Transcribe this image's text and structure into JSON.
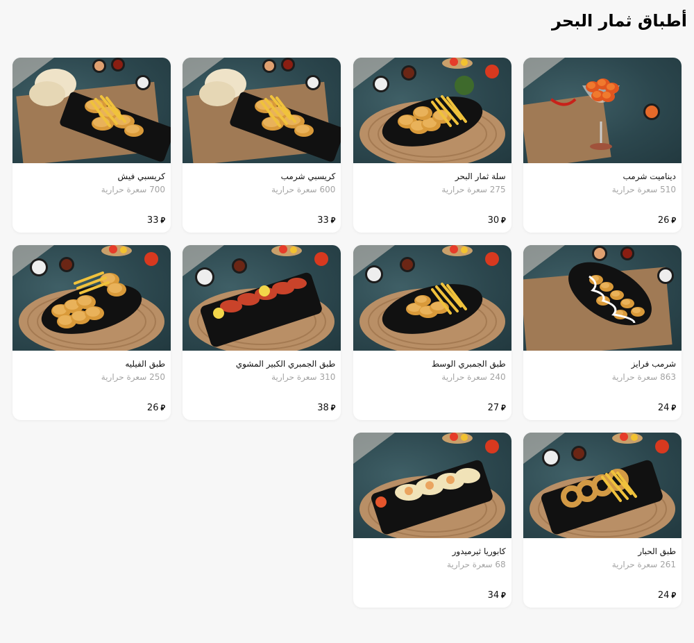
{
  "page": {
    "title": "أطباق ثمار البحر",
    "currency_symbol": "⃁",
    "calorie_unit": "سعرة حرارية"
  },
  "items": [
    {
      "name": "ديناميت شرمب",
      "calories": "510",
      "price": "26",
      "dish": "dynamite"
    },
    {
      "name": "سلة ثمار البحر",
      "calories": "275",
      "price": "30",
      "dish": "basket"
    },
    {
      "name": "كريسبي شرمب",
      "calories": "600",
      "price": "33",
      "dish": "crispy"
    },
    {
      "name": "كريسبي فيش",
      "calories": "700",
      "price": "33",
      "dish": "crispy"
    },
    {
      "name": "شرمب فرايز",
      "calories": "863",
      "price": "24",
      "dish": "fries"
    },
    {
      "name": "طبق الجمبري الوسط",
      "calories": "240",
      "price": "27",
      "dish": "shrimp"
    },
    {
      "name": "طبق الجمبري الكبير المشوي",
      "calories": "310",
      "price": "38",
      "dish": "grilled"
    },
    {
      "name": "طبق الفيليه",
      "calories": "250",
      "price": "26",
      "dish": "fillet"
    },
    {
      "name": "طبق الحبار",
      "calories": "261",
      "price": "24",
      "dish": "calamari"
    },
    {
      "name": "كابوريا ثيرميدور",
      "calories": "68",
      "price": "34",
      "dish": "crab"
    }
  ],
  "colors": {
    "background": "#f7f7f7",
    "card": "#ffffff",
    "muted_text": "#a3a3a3",
    "photo_backdrop": "#2c474e"
  }
}
